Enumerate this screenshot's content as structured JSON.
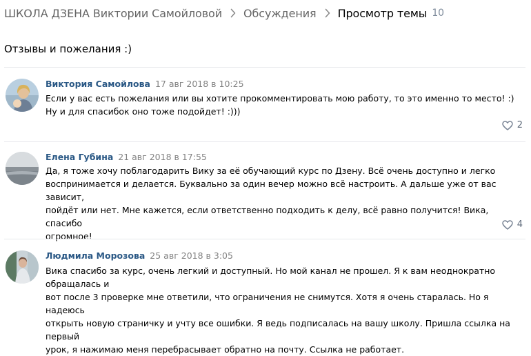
{
  "breadcrumb": {
    "community": "ШКОЛА ДЗЕНА Виктории Самойловой",
    "section": "Обсуждения",
    "current": "Просмотр темы",
    "count": "10"
  },
  "topic": {
    "title": "Отзывы и пожелания :)"
  },
  "posts": [
    {
      "author": "Виктория Самойлова",
      "date": "17 авг 2018 в 10:25",
      "text": "Если у вас есть пожелания или вы хотите прокомментировать мою работу, то это именно то место! :)\nНу и для спасибок оно тоже подойдет! :)))",
      "likes": "2"
    },
    {
      "author": "Елена Губина",
      "date": "21 авг 2018 в 17:55",
      "text": "Да, я тоже хочу поблагодарить Вику за её обучающий курс по Дзену. Всё очень доступно и легко\nвоспринимается и делается. Буквально за один вечер можно всё настроить. А дальше уже от вас зависит,\nпойдёт или нет. Мне кажется, если ответственно подходить к делу, всё равно получится! Вика, спасибо\nогромное!",
      "likes": "4"
    },
    {
      "author": "Людмила Морозова",
      "date": "25 авг 2018 в 3:05",
      "text": "Вика спасибо за курс, очень легкий и доступный. Но мой канал не прошел. Я к вам неоднократно обращалась и\nвот после 3 проверке мне ответили, что ограничения не снимутся. Хотя я очень старалась. Но я надеюсь\nоткрыть новую страничку и учту все ошибки. Я ведь подписалась на вашу школу. Пришла ссылка на первый\nурок, я нажимаю меня перебрасывает обратно на почту. Ссылка не работает."
    }
  ],
  "colors": {
    "link": "#2a5885",
    "muted": "#828282",
    "divider": "#e7e8ec"
  },
  "icons": {
    "breadcrumb_separator": "chevron-right-icon",
    "like": "heart-icon"
  }
}
